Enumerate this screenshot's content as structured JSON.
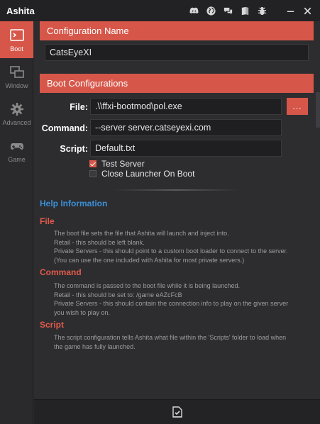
{
  "window": {
    "title": "Ashita"
  },
  "titlebar": {
    "icons": [
      "discord-icon",
      "globe-icon",
      "chat-icon",
      "book-icon",
      "bug-icon",
      "minimize-icon",
      "close-icon"
    ]
  },
  "sidebar": {
    "items": [
      {
        "label": "Boot",
        "icon": "terminal-icon",
        "active": true
      },
      {
        "label": "Window",
        "icon": "window-icon",
        "active": false
      },
      {
        "label": "Advanced",
        "icon": "gear-icon",
        "active": false
      },
      {
        "label": "Game",
        "icon": "gamepad-icon",
        "active": false
      }
    ]
  },
  "config_name": {
    "header": "Configuration Name",
    "value": "CatsEyeXI"
  },
  "boot": {
    "header": "Boot Configurations",
    "file_label": "File:",
    "file_value": ".\\\\ffxi-bootmod\\pol.exe",
    "browse_label": "...",
    "command_label": "Command:",
    "command_value": "--server server.catseyexi.com",
    "script_label": "Script:",
    "script_value": "Default.txt",
    "test_server_label": "Test Server",
    "test_server_checked": true,
    "close_launcher_label": "Close Launcher On Boot",
    "close_launcher_checked": false
  },
  "help": {
    "title": "Help Information",
    "file_heading": "File",
    "file_lines": [
      "The boot file sets the file that Ashita will launch and inject into.",
      "Retail - this should be left blank.",
      "Private Servers - this should point to a custom boot loader to connect to the server.",
      "(You can use the one included with Ashita for most private servers.)"
    ],
    "command_heading": "Command",
    "command_lines": [
      "The command is passed to the boot file while it is being launched.",
      "Retail - this should be set to: /game eAZcFcB",
      "Private Servers - this should contain the connection info to play on the given server",
      "you wish to play on."
    ],
    "script_heading": "Script",
    "script_lines": [
      "The script configuration tells Ashita what file within the 'Scripts' folder to load when",
      "the game has fully launched."
    ]
  },
  "footer": {
    "icon": "save-icon"
  },
  "colors": {
    "accent": "#d6574a",
    "link": "#3b8fd6",
    "background": "#2d2d30"
  }
}
